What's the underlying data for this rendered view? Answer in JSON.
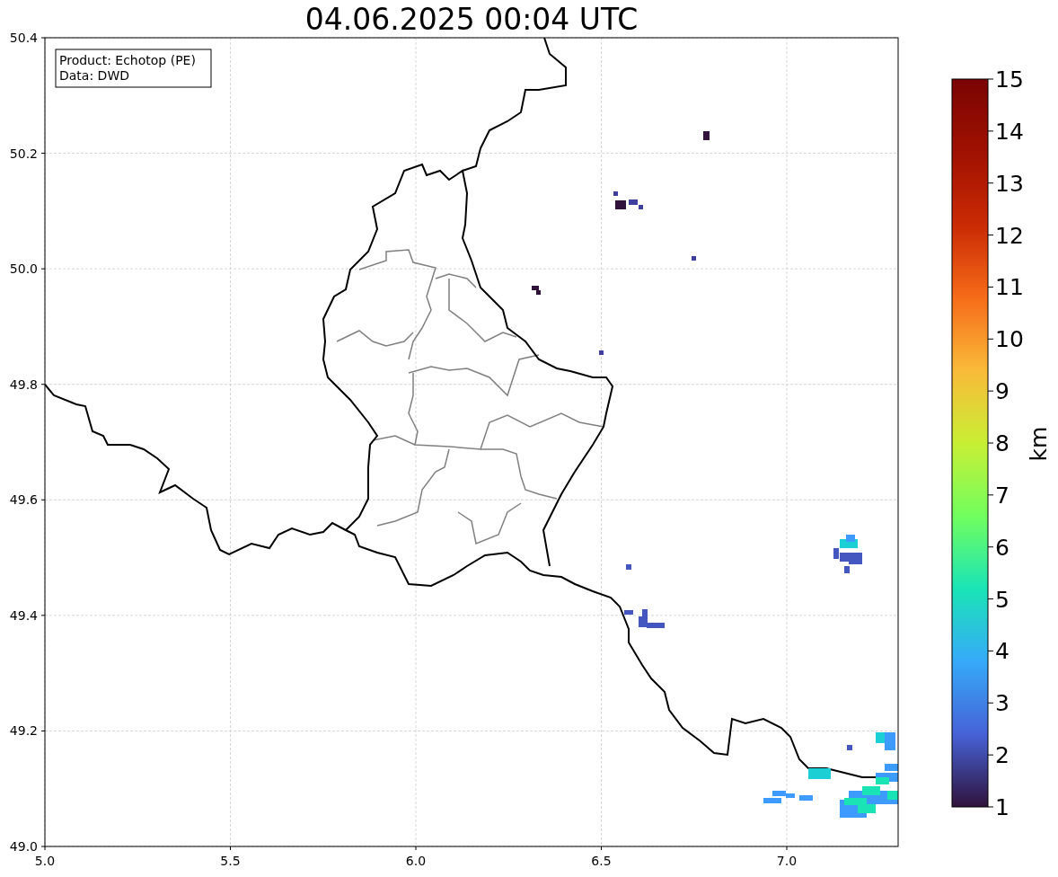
{
  "title": "04.06.2025 00:04 UTC",
  "legend": [
    "Product: Echotop (PE)",
    "Data: DWD"
  ],
  "x_axis": {
    "ticks": [
      "5.0",
      "5.5",
      "6.0",
      "6.5",
      "7.0"
    ]
  },
  "y_axis": {
    "ticks": [
      "50.4",
      "50.2",
      "50.0",
      "49.8",
      "49.6",
      "49.4",
      "49.2",
      "49.0"
    ]
  },
  "colorbar": {
    "label": "km",
    "ticks": [
      "15",
      "14",
      "13",
      "12",
      "11",
      "10",
      "9",
      "8",
      "7",
      "6",
      "5",
      "4",
      "3",
      "2",
      "1"
    ]
  }
}
